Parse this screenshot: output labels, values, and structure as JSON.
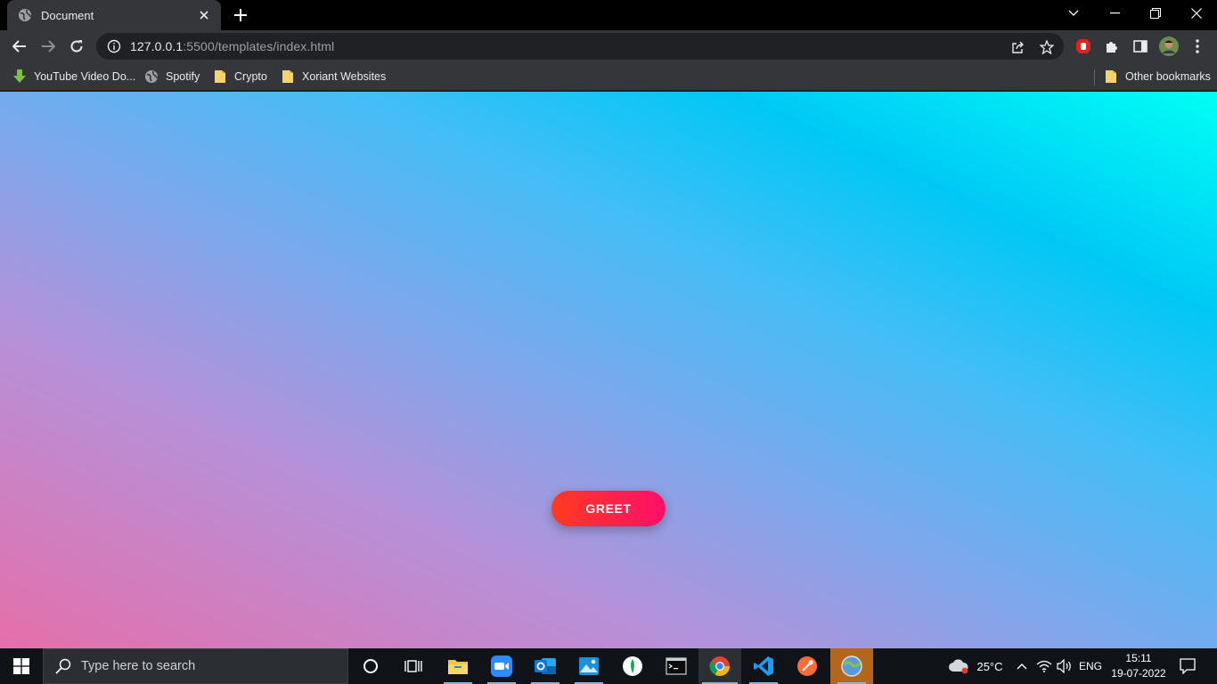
{
  "browser": {
    "tab": {
      "title": "Document"
    },
    "address": {
      "host": "127.0.0.1",
      "path": ":5500/templates/index.html"
    },
    "bookmarks": [
      {
        "label": "YouTube Video Do...",
        "icon": "download-arrow-icon"
      },
      {
        "label": "Spotify",
        "icon": "globe-icon"
      },
      {
        "label": "Crypto",
        "icon": "folder-icon"
      },
      {
        "label": "Xoriant Websites",
        "icon": "folder-icon"
      }
    ],
    "other_bookmarks": "Other bookmarks"
  },
  "page": {
    "button_label": "GREET",
    "gradient_colors": [
      "#e56faa",
      "#b790d8",
      "#7fa7ec",
      "#45bdf6",
      "#00c8f6",
      "#00fff5"
    ],
    "button_colors": [
      "#ff3a1f",
      "#ff0f6a"
    ]
  },
  "taskbar": {
    "search_placeholder": "Type here to search",
    "apps": [
      "cortana",
      "task-view",
      "file-explorer",
      "zoom",
      "outlook",
      "photos",
      "mongodb-compass",
      "terminal",
      "chrome",
      "vscode",
      "postman",
      "browser"
    ],
    "weather": "25°C",
    "language": "ENG",
    "time": "15:11",
    "date": "19-07-2022"
  }
}
